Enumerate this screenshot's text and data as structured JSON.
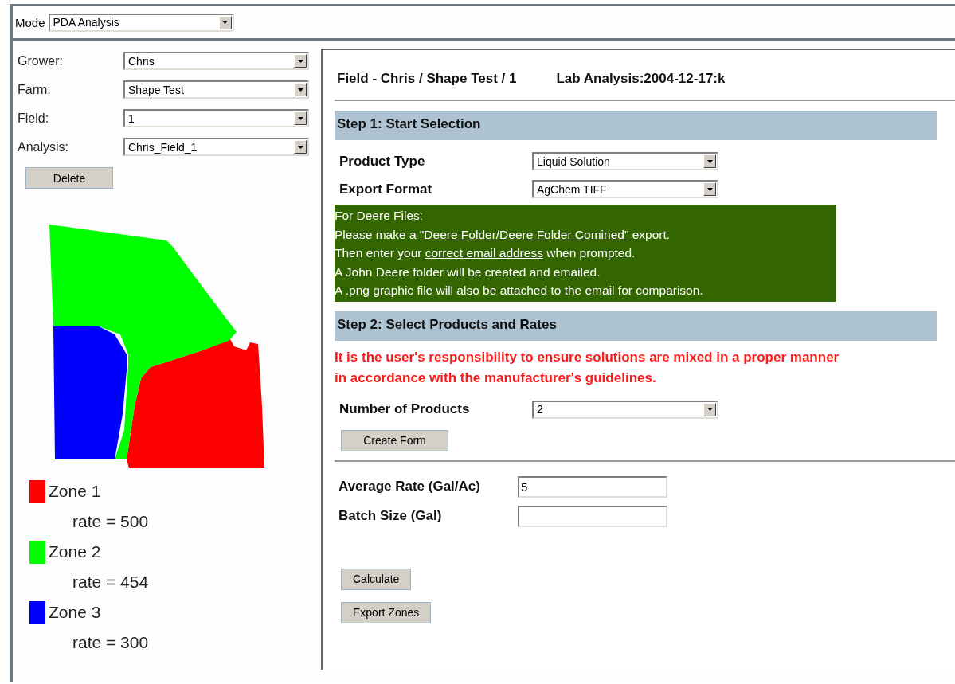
{
  "mode": {
    "label": "Mode",
    "value": "PDA Analysis"
  },
  "filters": [
    {
      "label": "Grower:",
      "value": "Chris"
    },
    {
      "label": "Farm:",
      "value": "Shape Test"
    },
    {
      "label": "Field:",
      "value": "1"
    },
    {
      "label": "Analysis:",
      "value": "Chris_Field_1"
    }
  ],
  "delete_button": "Delete",
  "legend": [
    {
      "name": "Zone 1",
      "color": "#ff0000",
      "rate": "rate = 500"
    },
    {
      "name": "Zone 2",
      "color": "#00ff00",
      "rate": "rate = 454"
    },
    {
      "name": "Zone 3",
      "color": "#0000ff",
      "rate": "rate = 300"
    }
  ],
  "header": {
    "field": "Field - Chris / Shape Test / 1",
    "lab": "Lab Analysis:2004-12-17:k"
  },
  "step1": {
    "title": "Step 1: Start Selection",
    "fields": [
      {
        "label": "Product Type",
        "value": "Liquid Solution"
      },
      {
        "label": "Export Format",
        "value": "AgChem TIFF"
      }
    ]
  },
  "note": {
    "lines": [
      [
        {
          "kind": "text",
          "text": "For Deere Files:"
        }
      ],
      [
        {
          "kind": "text",
          "text": "Please make a "
        },
        {
          "kind": "link",
          "text": "\"Deere Folder/Deere Folder Comined\""
        },
        {
          "kind": "text",
          "text": " export."
        }
      ],
      [
        {
          "kind": "text",
          "text": "Then enter your "
        },
        {
          "kind": "link",
          "text": "correct email address"
        },
        {
          "kind": "text",
          "text": " when prompted."
        }
      ],
      [
        {
          "kind": "text",
          "text": "A John Deere folder will be created and emailed."
        }
      ],
      [
        {
          "kind": "text",
          "text": "A .png graphic file will also be attached to the email for comparison."
        }
      ]
    ]
  },
  "step2": {
    "title": "Step 2: Select Products and Rates",
    "warning": "It is the user's responsibility to ensure solutions are mixed in a proper manner in accordance with the manufacturer's guidelines.",
    "products": {
      "label": "Number of Products",
      "value": "2"
    },
    "create_button": "Create Form",
    "inputs": [
      {
        "label": "Average Rate (Gal/Ac)",
        "value": "5"
      },
      {
        "label": "Batch Size (Gal)"
      }
    ],
    "buttons": [
      "Calculate",
      "Export Zones"
    ]
  }
}
